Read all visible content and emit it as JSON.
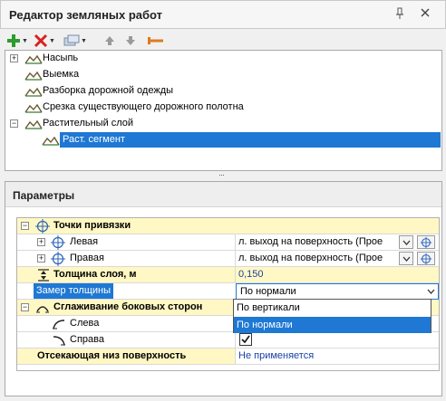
{
  "window": {
    "title": "Редактор земляных работ"
  },
  "tree": {
    "items": [
      {
        "label": "Насыпь",
        "expanded": false
      },
      {
        "label": "Выемка"
      },
      {
        "label": "Разборка дорожной одежды"
      },
      {
        "label": "Срезка существующего дорожного полотна"
      },
      {
        "label": "Растительный слой",
        "expanded": true
      },
      {
        "label": "Раст. сегмент",
        "selected": true
      }
    ]
  },
  "params": {
    "title": "Параметры",
    "rows": {
      "anchor_points": "Точки привязки",
      "left": {
        "name": "Левая",
        "value": "л. выход на поверхность (Прое"
      },
      "right": {
        "name": "Правая",
        "value": "л. выход на поверхность (Прое"
      },
      "thickness": {
        "name": "Толщина слоя, м",
        "value": "0,150"
      },
      "measure": {
        "name": "Замер толщины",
        "value": "По нормали"
      },
      "smoothing": "Сглаживание боковых сторон",
      "smooth_left": {
        "name": "Слева"
      },
      "smooth_right": {
        "name": "Справа",
        "checked": true
      },
      "cutoff": {
        "name": "Отсекающая низ поверхность",
        "value": "Не применяется"
      }
    },
    "dropdown_options": [
      "По вертикали",
      "По нормали"
    ],
    "dropdown_highlighted": "По нормали"
  },
  "colors": {
    "accent": "#1e78d4",
    "category_bg": "#fff8c4"
  }
}
